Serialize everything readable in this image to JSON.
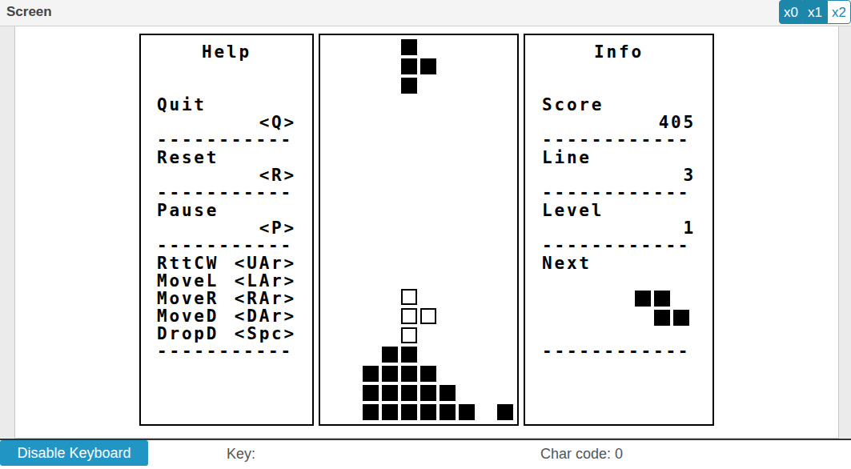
{
  "window": {
    "title": "Screen"
  },
  "scale_buttons": [
    {
      "label": "x0",
      "active": true
    },
    {
      "label": "x1",
      "active": true
    },
    {
      "label": "x2",
      "active": false
    }
  ],
  "help": {
    "title": "Help",
    "rule": "-----------",
    "commands": [
      {
        "label": "Quit",
        "key": "<Q>"
      },
      {
        "label": "Reset",
        "key": "<R>"
      },
      {
        "label": "Pause",
        "key": "<P>"
      }
    ],
    "controls": [
      {
        "label": "RttCW",
        "key": "<UAr>"
      },
      {
        "label": "MoveL",
        "key": "<LAr>"
      },
      {
        "label": "MoveR",
        "key": "<RAr>"
      },
      {
        "label": "MoveD",
        "key": "<DAr>"
      },
      {
        "label": "DropD",
        "key": "<Spc>"
      }
    ]
  },
  "board": {
    "rows": [
      "....#.....",
      "....##....",
      "....#.....",
      "..........",
      "..........",
      "..........",
      "..........",
      "..........",
      "..........",
      "..........",
      "..........",
      "..........",
      "..........",
      "....o.....",
      "....oo....",
      "....o.....",
      "...##.....",
      "..####....",
      "..#####...",
      "..######.#"
    ]
  },
  "info": {
    "title": "Info",
    "rule": "------------",
    "stats": [
      {
        "label": "Score",
        "value": "405"
      },
      {
        "label": "Line",
        "value": "3"
      },
      {
        "label": "Level",
        "value": "1"
      }
    ],
    "next": {
      "label": "Next",
      "rows": [
        "##.",
        ".##"
      ]
    }
  },
  "status_bar": {
    "button": "Disable Keyboard",
    "key": "Key:",
    "char_code": "Char code: 0"
  }
}
